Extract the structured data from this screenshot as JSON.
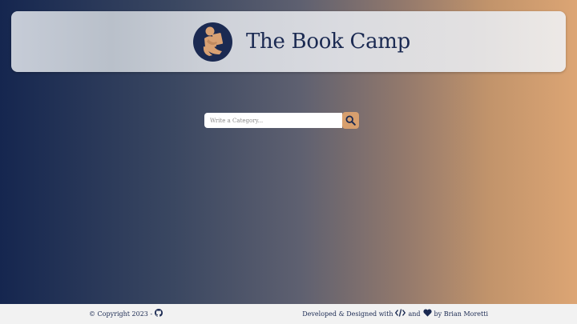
{
  "header": {
    "title": "The Book Camp",
    "logo_icon": "reading-person-logo-icon"
  },
  "search": {
    "placeholder": "Write a Category...",
    "value": "",
    "button_icon": "search-icon"
  },
  "footer": {
    "copyright_text": "© Copyright 2023 -",
    "github_icon": "github-icon",
    "credits_prefix": "Developed & Designed with",
    "code_icon": "code-icon",
    "credits_and": "and",
    "heart_icon": "heart-icon",
    "credits_suffix": "by Brian Moretti"
  },
  "colors": {
    "navy": "#1b2a52",
    "accent": "#d79f6e",
    "footer_bg": "#f2f2f2"
  }
}
